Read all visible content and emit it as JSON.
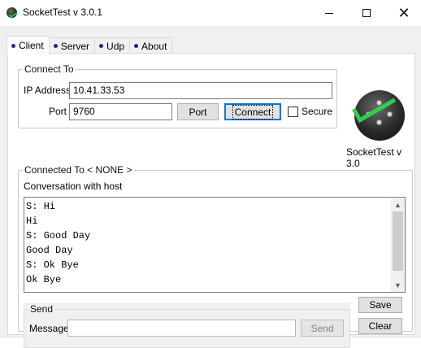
{
  "window": {
    "title": "SocketTest v 3.0.1"
  },
  "tabs": [
    {
      "label": "Client",
      "active": true
    },
    {
      "label": "Server",
      "active": false
    },
    {
      "label": "Udp",
      "active": false
    },
    {
      "label": "About",
      "active": false
    }
  ],
  "connect": {
    "group_title": "Connect To",
    "ip_label": "IP Address",
    "ip_value": "10.41.33.53",
    "port_label": "Port",
    "port_value": "9760",
    "port_button": "Port",
    "connect_button": "Connect",
    "secure_label": "Secure",
    "secure_checked": false
  },
  "logo": {
    "caption": "SocketTest v 3.0"
  },
  "connected": {
    "group_title": "Connected To < NONE >",
    "conversation_label": "Conversation with host",
    "conversation": [
      "S: Hi",
      "Hi",
      "S: Good Day",
      "Good Day",
      "S: Ok Bye",
      "Ok Bye"
    ]
  },
  "send": {
    "group_title": "Send",
    "message_label": "Message",
    "message_value": "",
    "send_button": "Send"
  },
  "actions": {
    "save_button": "Save",
    "clear_button": "Clear"
  },
  "colors": {
    "accent_check": "#2ed04b",
    "default_button_border": "#0078d7",
    "tab_bullet": "#1a2a7a"
  }
}
